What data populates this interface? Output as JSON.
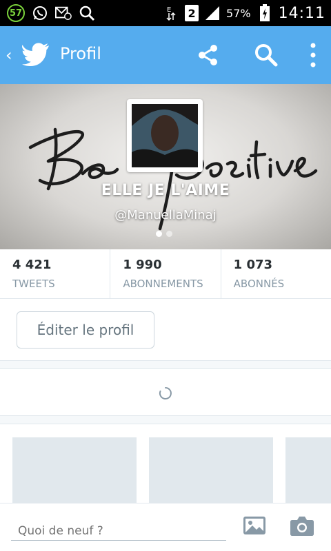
{
  "status_bar": {
    "notification_count": "57",
    "sim_slot": "2",
    "battery_percent": "57%",
    "time": "14:11",
    "icons": [
      "whatsapp-icon",
      "email-notification-icon",
      "search-icon",
      "data-transfer-icon",
      "signal-icon",
      "battery-charging-icon"
    ]
  },
  "app_bar": {
    "title": "Profil",
    "background_color": "#55acee",
    "actions": [
      "share-icon",
      "search-icon",
      "more-icon"
    ]
  },
  "profile": {
    "name": "ELLE JE L'AIME",
    "handle": "@ManuellaMinaj",
    "banner_script": "Be positive",
    "page_count": 2,
    "active_page": 1
  },
  "stats": [
    {
      "count": "4 421",
      "label": "TWEETS"
    },
    {
      "count": "1 990",
      "label": "ABONNEMENTS"
    },
    {
      "count": "1 073",
      "label": "ABONNÉS"
    }
  ],
  "edit_profile_label": "Éditer le profil",
  "compose": {
    "placeholder": "Quoi de neuf ?"
  },
  "colors": {
    "accent": "#55acee",
    "secondary_text": "#8899a6",
    "divider": "#e1e8ed"
  }
}
